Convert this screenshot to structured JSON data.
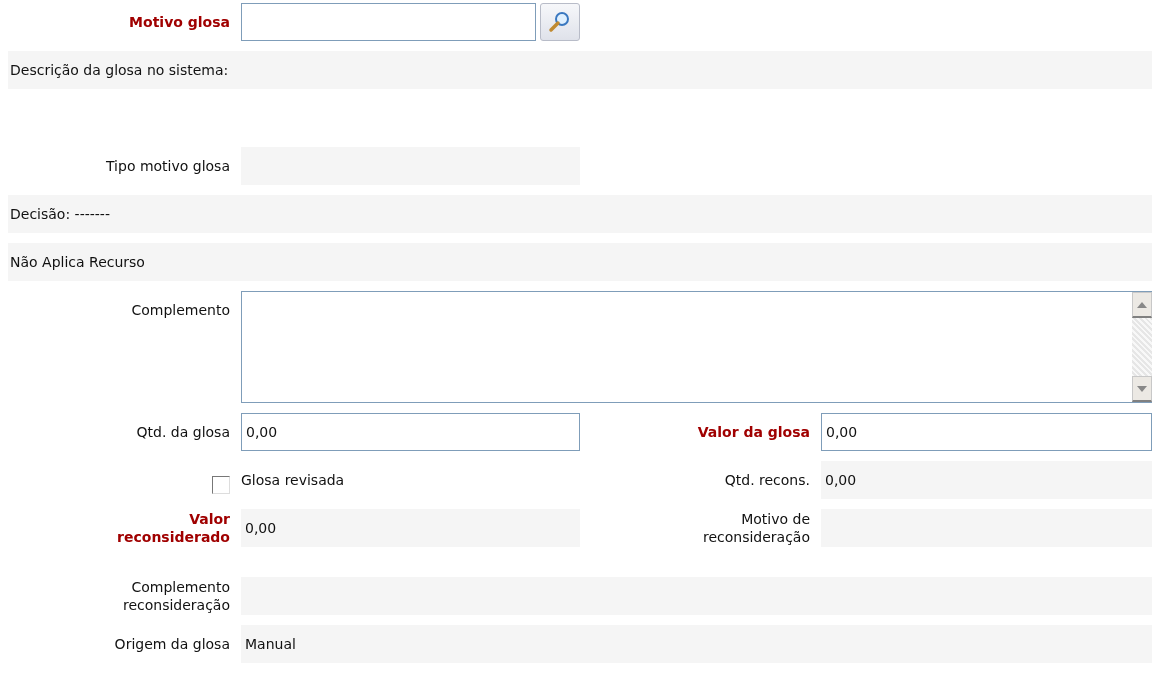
{
  "rows": [
    {
      "fields": [
        {
          "kind": "lookup",
          "label": "Motivo glosa",
          "required": true
        }
      ]
    },
    {
      "fields": [
        {
          "kind": "description",
          "text": "Descrição da glosa no sistema:"
        }
      ]
    },
    {
      "fields": [
        {
          "kind": "readonly",
          "label": "Tipo motivo glosa"
        }
      ]
    },
    {
      "fields": [
        {
          "kind": "banner",
          "text": "Decisão: -------"
        }
      ]
    },
    {
      "fields": [
        {
          "kind": "banner",
          "text": "Não Aplica Recurso"
        }
      ]
    },
    {
      "fields": [
        {
          "kind": "textarea",
          "label": "Complemento",
          "wide": true
        }
      ]
    },
    {
      "fields": [
        {
          "kind": "input",
          "label": "Qtd. da glosa",
          "value": "0,00"
        },
        {
          "kind": "input",
          "label": "Valor da glosa",
          "required": true,
          "value": "0,00"
        }
      ]
    },
    {
      "fields": [
        {
          "kind": "checkbox",
          "label": "Glosa revisada",
          "checked": false
        },
        {
          "kind": "readonly",
          "label": "Qtd. recons.",
          "value": "0,00"
        }
      ]
    },
    {
      "fields": [
        {
          "kind": "readonly",
          "label": "Valor reconsiderado",
          "required": true,
          "value": "0,00"
        },
        {
          "kind": "readonly",
          "label": "Motivo de reconsideração"
        }
      ]
    },
    {
      "fields": [
        {
          "kind": "readonly",
          "label": "Complemento reconsideração",
          "wide": true
        }
      ]
    },
    {
      "fields": [
        {
          "kind": "readonly",
          "label": "Origem da glosa",
          "value": "Manual",
          "wide": true
        }
      ]
    }
  ]
}
